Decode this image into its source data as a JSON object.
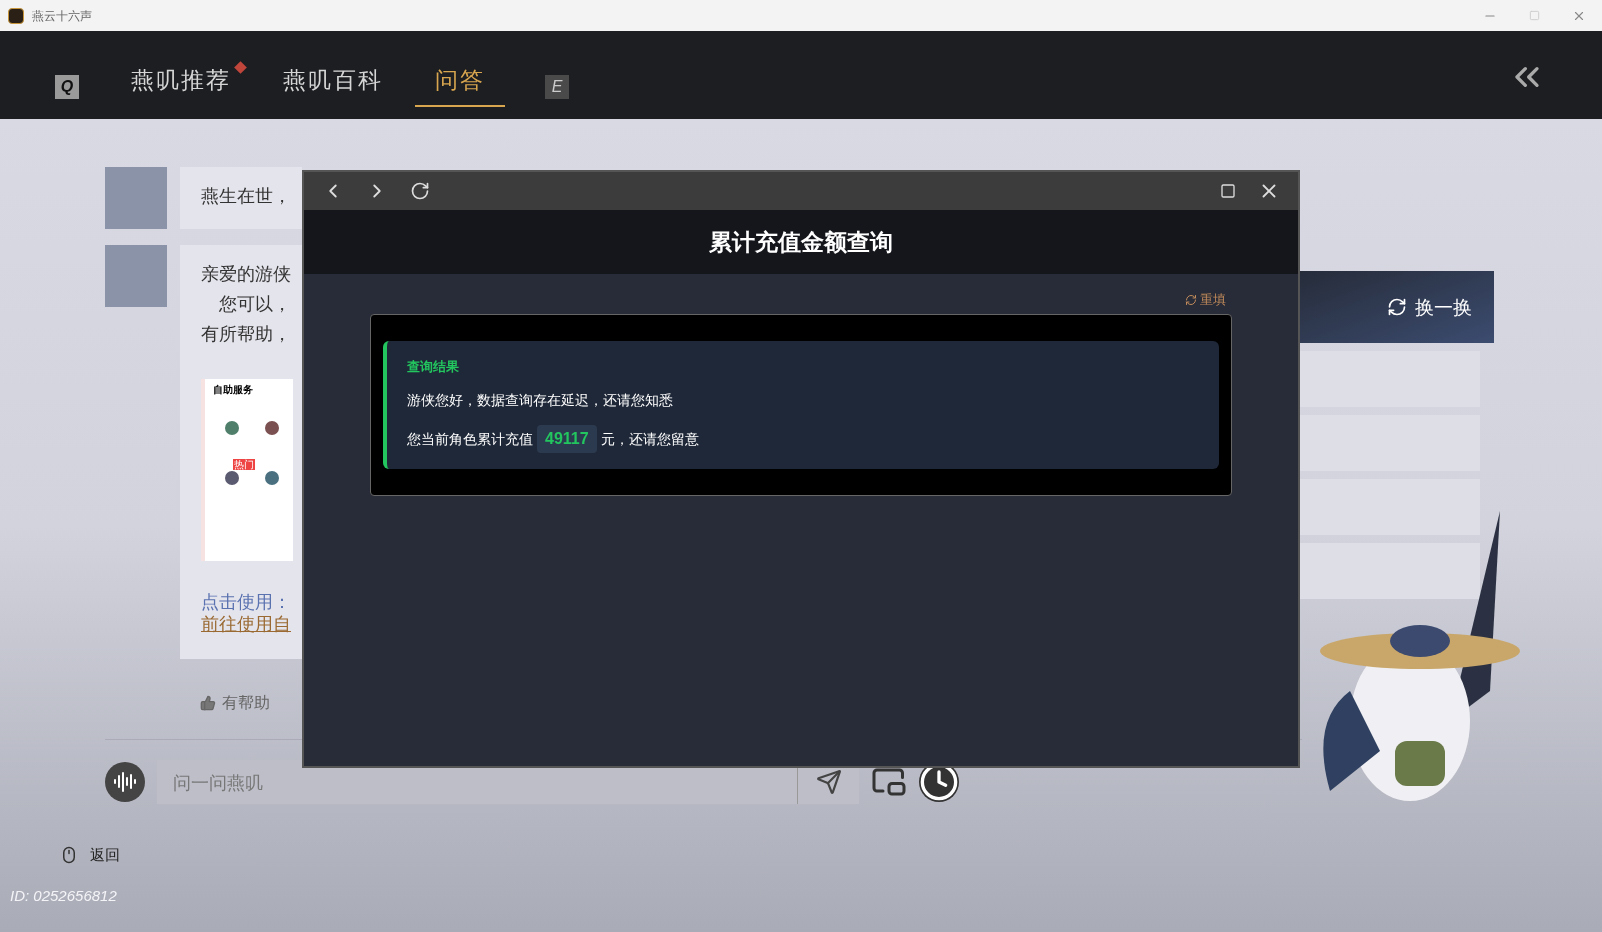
{
  "window": {
    "title": "燕云十六声"
  },
  "nav": {
    "left_key": "Q",
    "right_key": "E",
    "tabs": [
      {
        "label": "燕叽推荐",
        "selected": false,
        "badge": true
      },
      {
        "label": "燕叽百科",
        "selected": false,
        "badge": false
      },
      {
        "label": "问答",
        "selected": true,
        "badge": false
      }
    ]
  },
  "chat": {
    "messages": [
      {
        "lines": [
          "燕生在世，"
        ]
      },
      {
        "lines": [
          "亲爱的游侠",
          "　您可以，",
          "有所帮助，"
        ],
        "thumbnail": {
          "title": "自助服务",
          "badge": "热门"
        },
        "link_label": "点击使用：",
        "link": "前往使用自"
      }
    ],
    "feedback": "有帮助"
  },
  "input": {
    "placeholder": "问一问燕叽"
  },
  "side": {
    "refresh": "换一换"
  },
  "footer": {
    "back": "返回",
    "id": "ID: 0252656812"
  },
  "dialog": {
    "title": "累计充值金额查询",
    "reset": "重填",
    "result": {
      "heading": "查询结果",
      "line1": "游侠您好，数据查询存在延迟，还请您知悉",
      "prefix": "您当前角色累计充值",
      "amount": "49117",
      "suffix": "元，还请您留意"
    }
  }
}
